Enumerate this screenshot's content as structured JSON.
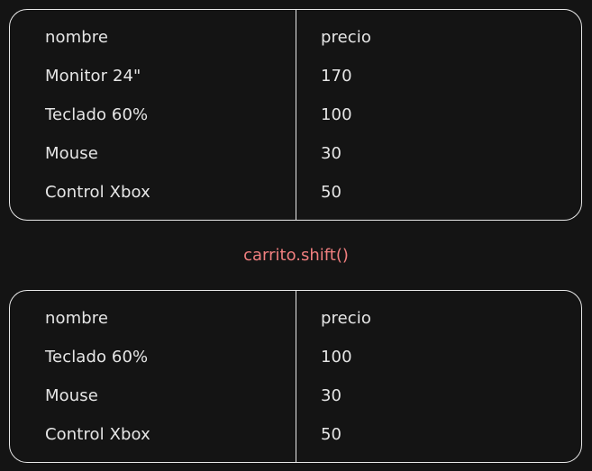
{
  "before_table": {
    "header": {
      "name": "nombre",
      "price": "precio"
    },
    "rows": [
      {
        "name": "Monitor 24\"",
        "price": "170"
      },
      {
        "name": "Teclado 60%",
        "price": "100"
      },
      {
        "name": "Mouse",
        "price": "30"
      },
      {
        "name": "Control Xbox",
        "price": "50"
      }
    ]
  },
  "operation": "carrito.shift()",
  "after_table": {
    "header": {
      "name": "nombre",
      "price": "precio"
    },
    "rows": [
      {
        "name": "Teclado 60%",
        "price": "100"
      },
      {
        "name": "Mouse",
        "price": "30"
      },
      {
        "name": "Control Xbox",
        "price": "50"
      }
    ]
  },
  "colors": {
    "background": "#141414",
    "text": "#e6e6e6",
    "border": "#e8e8e8",
    "operation_text": "#f07f7f"
  }
}
